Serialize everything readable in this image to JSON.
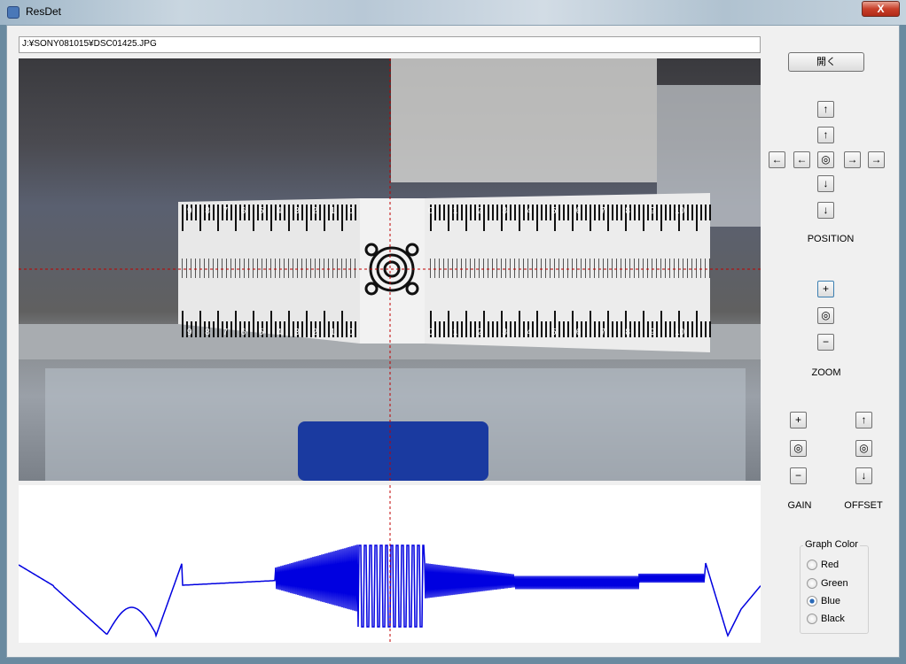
{
  "window": {
    "title": "ResDet",
    "close": "X"
  },
  "path": "J:¥SONY081015¥DSC01425.JPG",
  "open_button": "開く",
  "position": {
    "label": "POSITION",
    "up2": "↑",
    "up": "↑",
    "left2": "←",
    "left": "←",
    "center": "◎",
    "right": "→",
    "right2": "→",
    "down": "↓",
    "down2": "↓"
  },
  "zoom": {
    "label": "ZOOM",
    "in": "+",
    "reset": "◎",
    "out": "−"
  },
  "gain": {
    "label": "GAIN",
    "plus": "+",
    "reset": "◎",
    "minus": "−"
  },
  "offset": {
    "label": "OFFSET",
    "up": "↑",
    "reset": "◎",
    "down": "↓"
  },
  "graph_color": {
    "title": "Graph Color",
    "options": [
      "Red",
      "Green",
      "Blue",
      "Black"
    ],
    "selected": "Blue"
  },
  "chart_labels": {
    "left": [
      "9",
      "8",
      "7",
      "6",
      "5",
      "4",
      "3",
      "2",
      "1",
      "0"
    ],
    "right": [
      "0",
      "1",
      "2",
      "3",
      "4",
      "5",
      "6",
      "7",
      "8",
      "9",
      "10"
    ]
  },
  "colors": {
    "graph": "#0000e0",
    "crosshair": "#c00000"
  }
}
